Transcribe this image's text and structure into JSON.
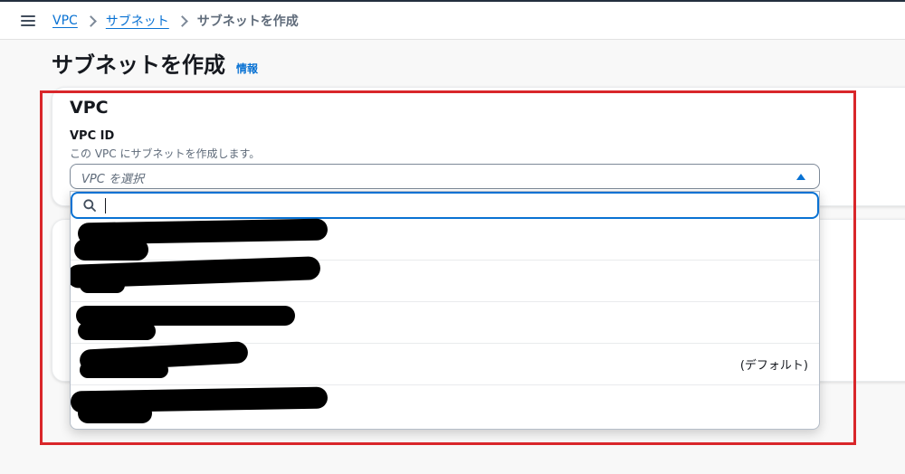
{
  "header": {
    "menu_icon": "hamburger-menu-icon"
  },
  "breadcrumb": {
    "items": [
      {
        "label": "VPC"
      },
      {
        "label": "サブネット"
      }
    ],
    "current": "サブネットを作成"
  },
  "page": {
    "title": "サブネットを作成",
    "info_link": "情報"
  },
  "vpc_section": {
    "title": "VPC",
    "field_label": "VPC ID",
    "field_description": "この VPC にサブネットを作成します。",
    "select_placeholder": "VPC を選択",
    "search_value": ""
  },
  "dropdown": {
    "options": [
      {
        "suffix": ""
      },
      {
        "suffix": ""
      },
      {
        "suffix": ""
      },
      {
        "suffix": "(デフォルト)"
      },
      {
        "suffix": ""
      }
    ]
  },
  "colors": {
    "accent": "#0972d3",
    "highlight": "#d9262a",
    "text": "#16191f",
    "muted": "#5f6b7a"
  }
}
